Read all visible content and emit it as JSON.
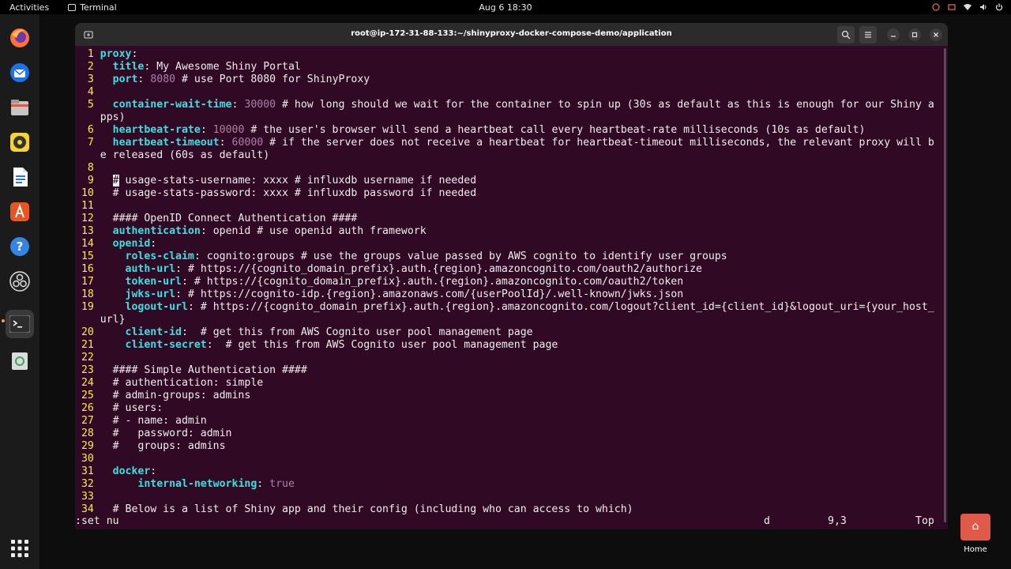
{
  "topbar": {
    "activities": "Activities",
    "app_name": "Terminal",
    "clock": "Aug 6  18:30"
  },
  "dock": {
    "items": [
      "firefox-icon",
      "thunderbird-icon",
      "files-icon",
      "rhythmbox-icon",
      "writer-icon",
      "app-center-icon",
      "help-icon",
      "obs-icon",
      "terminal-icon",
      "trash-icon"
    ],
    "apps_grid": "apps-grid-icon"
  },
  "window": {
    "title": "root@ip-172-31-88-133:~/shinyproxy-docker-compose-demo/application"
  },
  "editor": {
    "lines": [
      [
        [
          "ln",
          "1 "
        ],
        [
          "k",
          "proxy"
        ],
        [
          "",
          "："
        ]
      ],
      [
        [
          "ln",
          "2 "
        ],
        [
          "",
          ""
        ]
      ]
    ],
    "status_cmd": ":set nu",
    "status_mode": "d",
    "status_pos": "9,3",
    "status_scroll": "Top"
  },
  "desktop": {
    "home_label": "Home"
  }
}
